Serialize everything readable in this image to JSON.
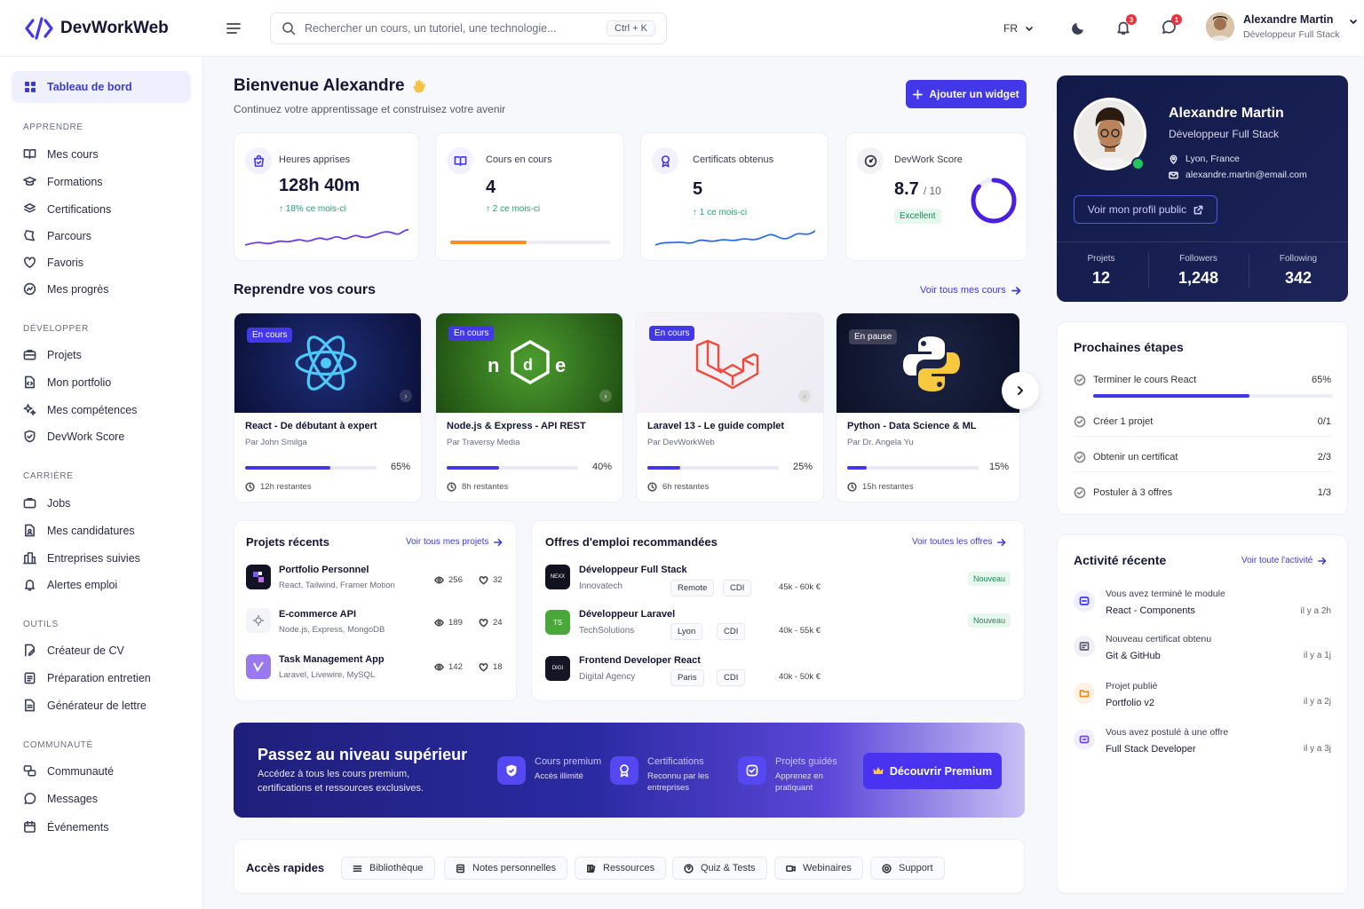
{
  "app": {
    "name": "DevWorkWeb"
  },
  "header": {
    "search_placeholder": "Rechercher un cours, un tutoriel, une technologie...",
    "search_shortcut": "Ctrl + K",
    "lang": "FR",
    "notif_count": "3",
    "msg_count": "1",
    "user_name": "Alexandre Martin",
    "user_role": "Développeur Full Stack"
  },
  "sidebar": {
    "active": "Tableau de bord",
    "sections": [
      {
        "title": "APPRENDRE",
        "items": [
          "Mes cours",
          "Formations",
          "Certifications",
          "Parcours",
          "Favoris",
          "Mes progrès"
        ]
      },
      {
        "title": "DÉVELOPPER",
        "items": [
          "Projets",
          "Mon portfolio",
          "Mes compétences",
          "DevWork Score"
        ]
      },
      {
        "title": "CARRIÈRE",
        "items": [
          "Jobs",
          "Mes candidatures",
          "Entreprises suivies",
          "Alertes emploi"
        ]
      },
      {
        "title": "OUTILS",
        "items": [
          "Créateur de CV",
          "Préparation entretien",
          "Générateur de lettre"
        ]
      },
      {
        "title": "COMMUNAUTÉ",
        "items": [
          "Communauté",
          "Messages",
          "Événements"
        ]
      }
    ]
  },
  "welcome": {
    "title": "Bienvenue Alexandre",
    "subtitle": "Continuez votre apprentissage et construisez votre avenir",
    "add_widget": "Ajouter un widget"
  },
  "stats": [
    {
      "label": "Heures apprises",
      "value": "128h 40m",
      "sub": "18% ce mois-ci"
    },
    {
      "label": "Cours en cours",
      "value": "4",
      "sub": "2 ce mois-ci",
      "progress": 0.48
    },
    {
      "label": "Certificats obtenus",
      "value": "5",
      "sub": "1 ce mois-ci"
    },
    {
      "label": "DevWork Score",
      "value": "8.7",
      "unit": "/ 10",
      "badge": "Excellent",
      "score": 0.87
    }
  ],
  "courses_section": {
    "title": "Reprendre vos cours",
    "link": "Voir tous mes cours"
  },
  "courses": [
    {
      "tag": "En cours",
      "title": "React - De débutant à expert",
      "author": "Par John Smilga",
      "percent": "65%",
      "progress": 0.65,
      "remaining": "12h restantes"
    },
    {
      "tag": "En cours",
      "title": "Node.js & Express - API REST",
      "author": "Par Traversy Media",
      "percent": "40%",
      "progress": 0.4,
      "remaining": "8h restantes"
    },
    {
      "tag": "En cours",
      "title": "Laravel 13 - Le guide complet",
      "author": "Par DevWorkWeb",
      "percent": "25%",
      "progress": 0.25,
      "remaining": "6h restantes"
    },
    {
      "tag": "En pause",
      "title": "Python - Data Science & ML",
      "author": "Par Dr. Angela Yu",
      "percent": "15%",
      "progress": 0.15,
      "remaining": "15h restantes"
    }
  ],
  "projects": {
    "title": "Projets récents",
    "link": "Voir tous mes projets",
    "items": [
      {
        "name": "Portfolio Personnel",
        "stack": "React, Tailwind, Framer Motion",
        "views": "256",
        "likes": "32"
      },
      {
        "name": "E-commerce API",
        "stack": "Node.js, Express, MongoDB",
        "views": "189",
        "likes": "24"
      },
      {
        "name": "Task Management App",
        "stack": "Laravel, Livewire, MySQL",
        "views": "142",
        "likes": "18"
      }
    ]
  },
  "jobs": {
    "title": "Offres d'emploi recommandées",
    "link": "Voir toutes les offres",
    "items": [
      {
        "logo": "NEXX",
        "title": "Développeur Full Stack",
        "company": "Innovatech",
        "loc": "Remote",
        "type": "CDI",
        "salary": "45k - 60k €",
        "badge": "Nouveau"
      },
      {
        "logo": "TS",
        "title": "Développeur Laravel",
        "company": "TechSolutions",
        "loc": "Lyon",
        "type": "CDI",
        "salary": "40k - 55k €",
        "badge": "Nouveau"
      },
      {
        "logo": "DIGI",
        "title": "Frontend Developer React",
        "company": "Digital Agency",
        "loc": "Paris",
        "type": "CDI",
        "salary": "40k - 50k €",
        "badge": ""
      }
    ]
  },
  "premium": {
    "title": "Passez au niveau supérieur",
    "desc": "Accédez à tous les cours premium, certifications et ressources exclusives.",
    "features": [
      {
        "title": "Cours premium",
        "sub": "Accès illimité"
      },
      {
        "title": "Certifications",
        "sub": "Reconnu par les entreprises"
      },
      {
        "title": "Projets guidés",
        "sub": "Apprenez en pratiquant"
      }
    ],
    "cta": "Découvrir Premium"
  },
  "quick": {
    "title": "Accès rapides",
    "items": [
      "Bibliothèque",
      "Notes personnelles",
      "Ressources",
      "Quiz & Tests",
      "Webinaires",
      "Support"
    ]
  },
  "profile": {
    "name": "Alexandre Martin",
    "role": "Développeur Full Stack",
    "location": "Lyon, France",
    "email": "alexandre.martin@email.com",
    "cta": "Voir mon profil public",
    "stats": [
      {
        "label": "Projets",
        "value": "12"
      },
      {
        "label": "Followers",
        "value": "1,248"
      },
      {
        "label": "Following",
        "value": "342"
      }
    ]
  },
  "next_steps": {
    "title": "Prochaines étapes",
    "items": [
      {
        "label": "Terminer le cours React",
        "value": "65%",
        "progress": 0.65
      },
      {
        "label": "Créer 1 projet",
        "value": "0/1"
      },
      {
        "label": "Obtenir un certificat",
        "value": "2/3"
      },
      {
        "label": "Postuler à 3 offres",
        "value": "1/3"
      }
    ]
  },
  "activity": {
    "title": "Activité récente",
    "link": "Voir toute l'activité",
    "items": [
      {
        "line1": "Vous avez terminé le module",
        "line2": "React - Components",
        "time": "il y a 2h"
      },
      {
        "line1": "Nouveau certificat obtenu",
        "line2": "Git & GitHub",
        "time": "il y a 1j"
      },
      {
        "line1": "Projet publié",
        "line2": "Portfolio v2",
        "time": "il y a 2j"
      },
      {
        "line1": "Vous avez postulé à une offre",
        "line2": "Full Stack Developer",
        "time": "il y a 3j"
      }
    ]
  },
  "colors": {
    "primary": "#4338e8",
    "success": "#22a36a",
    "orange": "#f7901e",
    "danger": "#ef2f3c"
  }
}
